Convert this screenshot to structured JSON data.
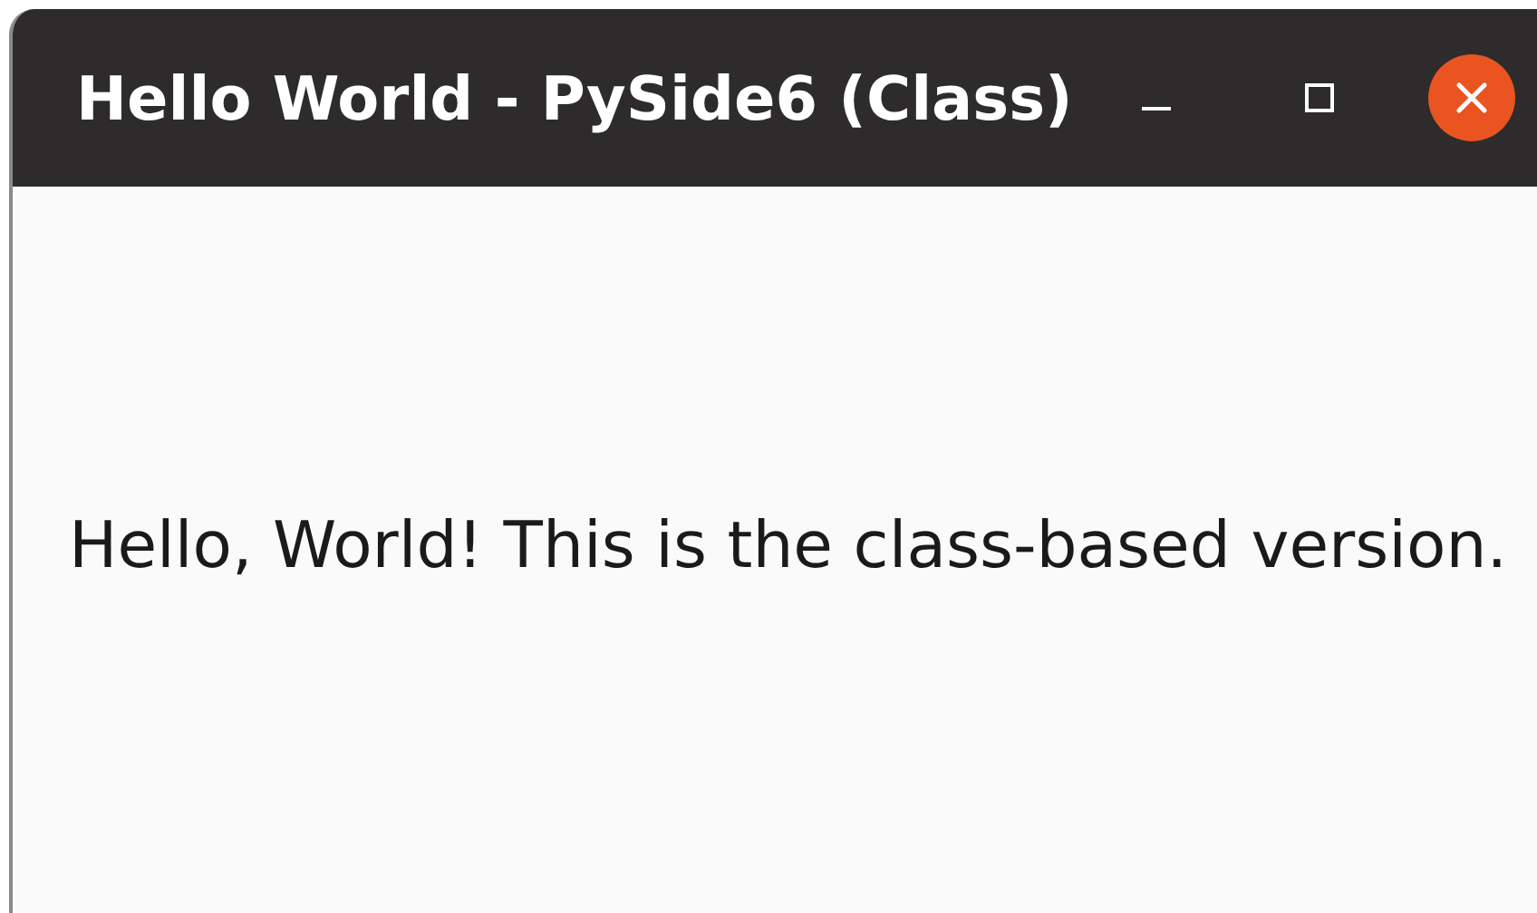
{
  "window": {
    "title": "Hello World - PySide6 (Class)"
  },
  "label": {
    "text": "Hello, World! This is the class-based version."
  }
}
